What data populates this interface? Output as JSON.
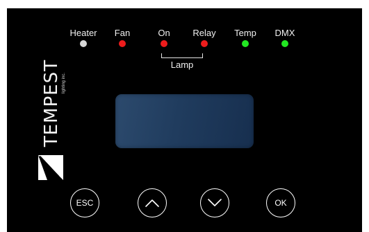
{
  "indicators": [
    {
      "label": "Heater",
      "color": "#d8d8d8"
    },
    {
      "label": "Fan",
      "color": "#ee1c1c"
    },
    {
      "label": "On",
      "color": "#ee1c1c"
    },
    {
      "label": "Relay",
      "color": "#ee1c1c"
    },
    {
      "label": "Temp",
      "color": "#22e822"
    },
    {
      "label": "DMX",
      "color": "#22e822"
    }
  ],
  "lamp_group_label": "Lamp",
  "logo": {
    "word": "TEMPEST",
    "sub": "lighting inc."
  },
  "buttons": {
    "esc_label": "ESC",
    "up_icon": "chevron-up-icon",
    "down_icon": "chevron-down-icon",
    "ok_label": "OK"
  },
  "colors": {
    "panel": "#000000",
    "display": "#203c5e"
  }
}
